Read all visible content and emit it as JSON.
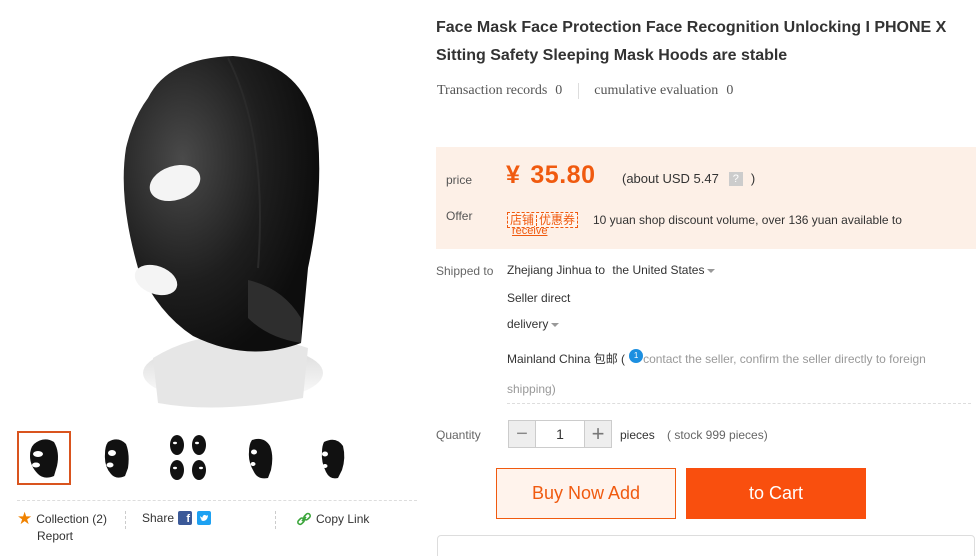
{
  "product": {
    "title": "Face Mask Face Protection Face Recognition Unlocking I PHONE X Sitting Safety Sleeping Mask Hoods are stable",
    "transaction_records_label": "Transaction records",
    "transaction_records_value": "0",
    "cumulative_evaluation_label": "cumulative evaluation",
    "cumulative_evaluation_value": "0"
  },
  "price": {
    "label": "price",
    "currency_symbol": "¥",
    "value": "35.80",
    "usd_text": "(about USD 5.47",
    "help_icon": "?",
    "usd_close": ")",
    "accent_color": "#f05a0f"
  },
  "offer": {
    "label": "Offer",
    "coupon_part1": "店铺",
    "coupon_part2": "优惠券",
    "text": "10 yuan shop discount volume, over 136 yuan available to",
    "receive_link": "receive"
  },
  "shipping": {
    "label": "Shipped to",
    "origin": "Zhejiang Jinhua to",
    "destination": "the United States",
    "seller_direct": "Seller direct",
    "delivery": "delivery",
    "region": "Mainland China 包邮 (",
    "info_badge": "1",
    "note": "contact the seller, confirm the seller directly to foreign shipping)"
  },
  "quantity": {
    "label": "Quantity",
    "value": "1",
    "minus_symbol": "−",
    "plus_symbol": "+",
    "unit": "pieces",
    "stock": "( stock 999 pieces)"
  },
  "actions": {
    "buy_now": "Buy Now Add",
    "add_to_cart": "to Cart"
  },
  "social": {
    "collection": "Collection (2)",
    "report": "Report",
    "share": "Share",
    "copy_link": "Copy Link"
  },
  "gallery": {
    "thumbnail_count": 5,
    "active_thumbnail": 1
  }
}
